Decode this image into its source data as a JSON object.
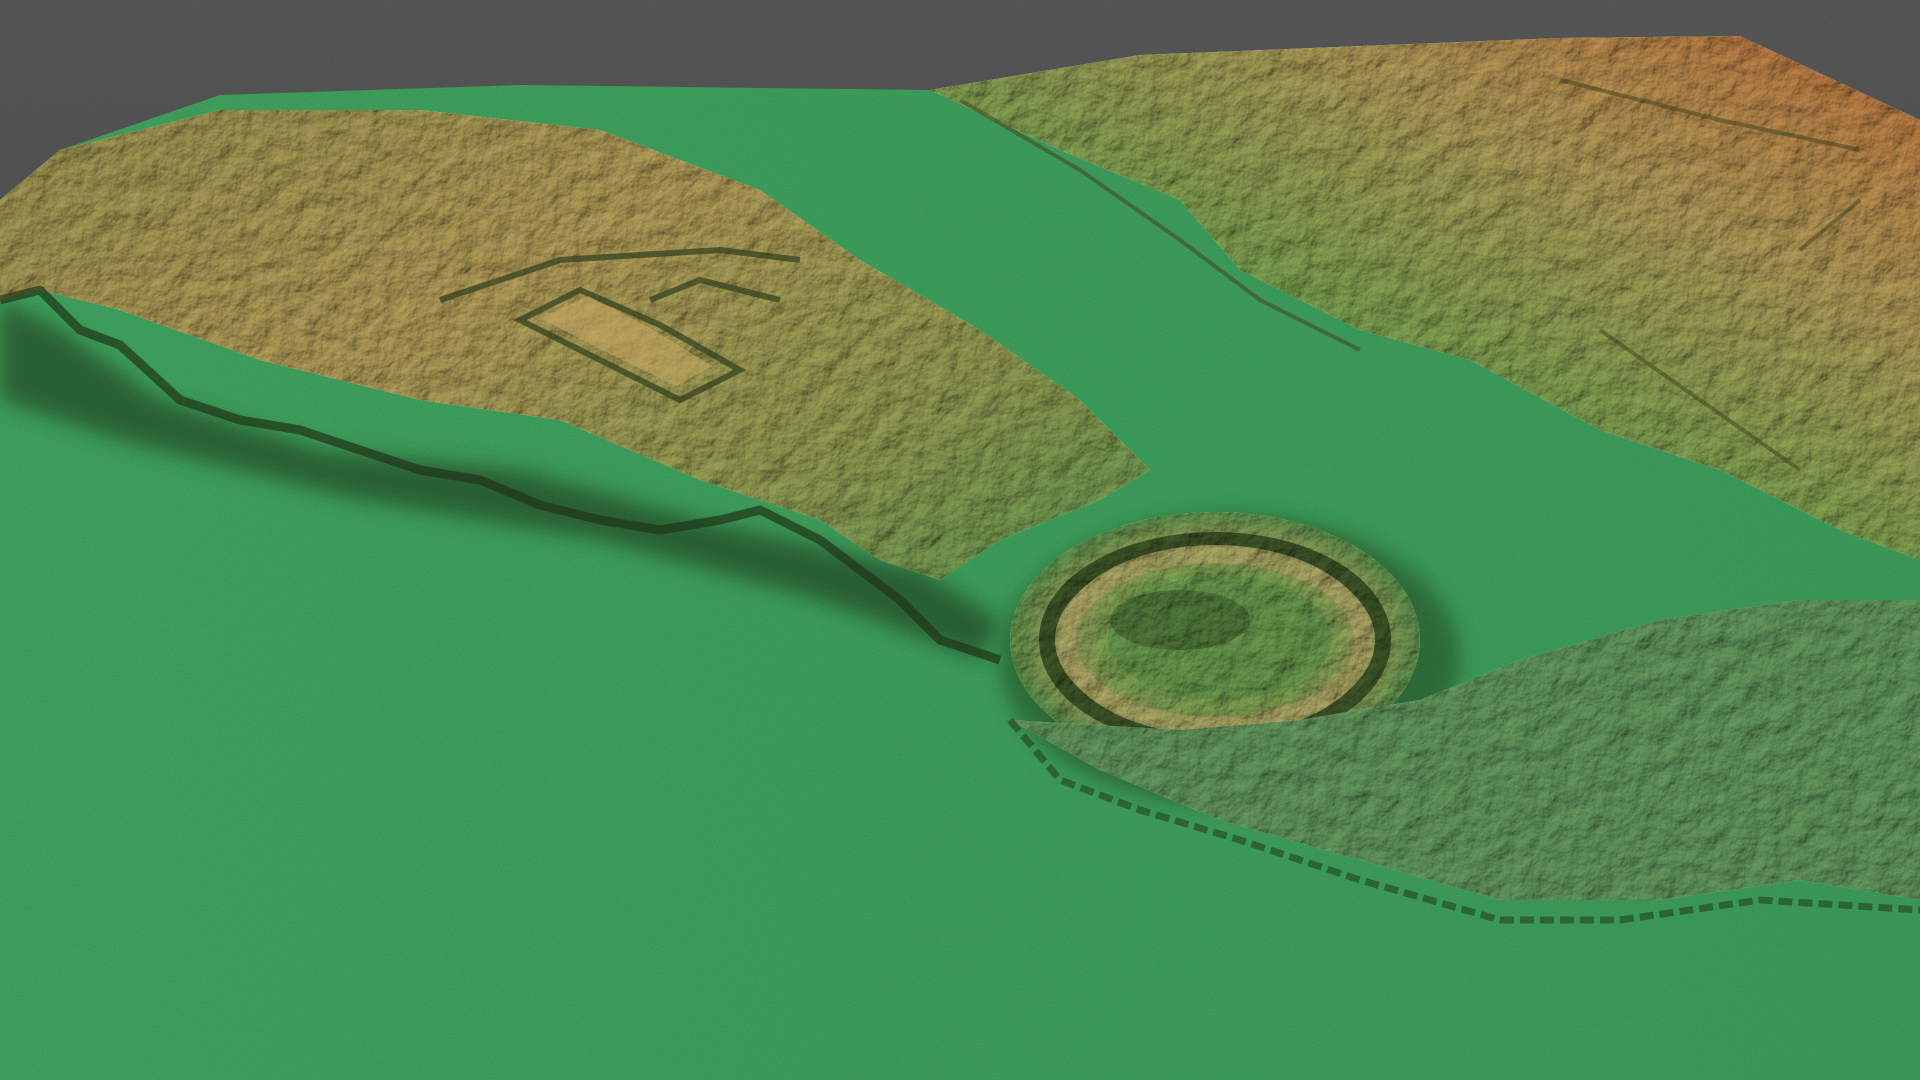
{
  "scene": {
    "subject": "terrain-elevation-model",
    "colors": {
      "background_top": "#5b5b5b",
      "background_bottom": "#3f3f3f",
      "lowland": "#41a862",
      "lowland_dark": "#3a9a58",
      "mid_green": "#7fb35a",
      "upland": "#c9b062",
      "ridge_gold": "#d8ad62",
      "peak_orange": "#d98a45",
      "shadow": "#1f3a18"
    }
  }
}
